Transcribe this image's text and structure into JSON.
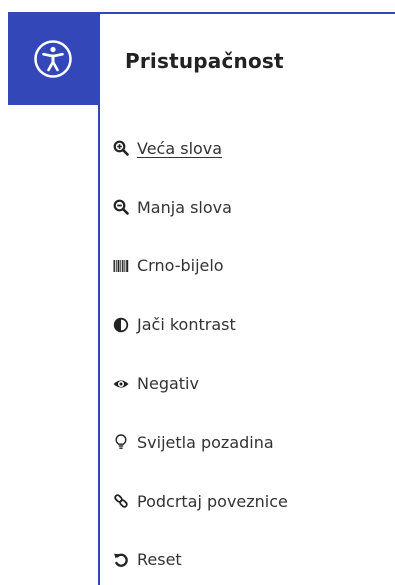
{
  "toggle": {
    "icon": "universal-access-icon",
    "color": "#3447b8"
  },
  "panel": {
    "title": "Pristupačnost",
    "items": [
      {
        "label": "Veća slova",
        "icon": "zoom-in-icon",
        "active": true
      },
      {
        "label": "Manja slova",
        "icon": "zoom-out-icon",
        "active": false
      },
      {
        "label": "Crno-bijelo",
        "icon": "barcode-icon",
        "active": false
      },
      {
        "label": "Jači kontrast",
        "icon": "contrast-icon",
        "active": false
      },
      {
        "label": "Negativ",
        "icon": "eye-icon",
        "active": false
      },
      {
        "label": "Svijetla pozadina",
        "icon": "lightbulb-icon",
        "active": false
      },
      {
        "label": "Podcrtaj poveznice",
        "icon": "link-icon",
        "active": false
      },
      {
        "label": "Reset",
        "icon": "reset-icon",
        "active": false
      }
    ]
  }
}
